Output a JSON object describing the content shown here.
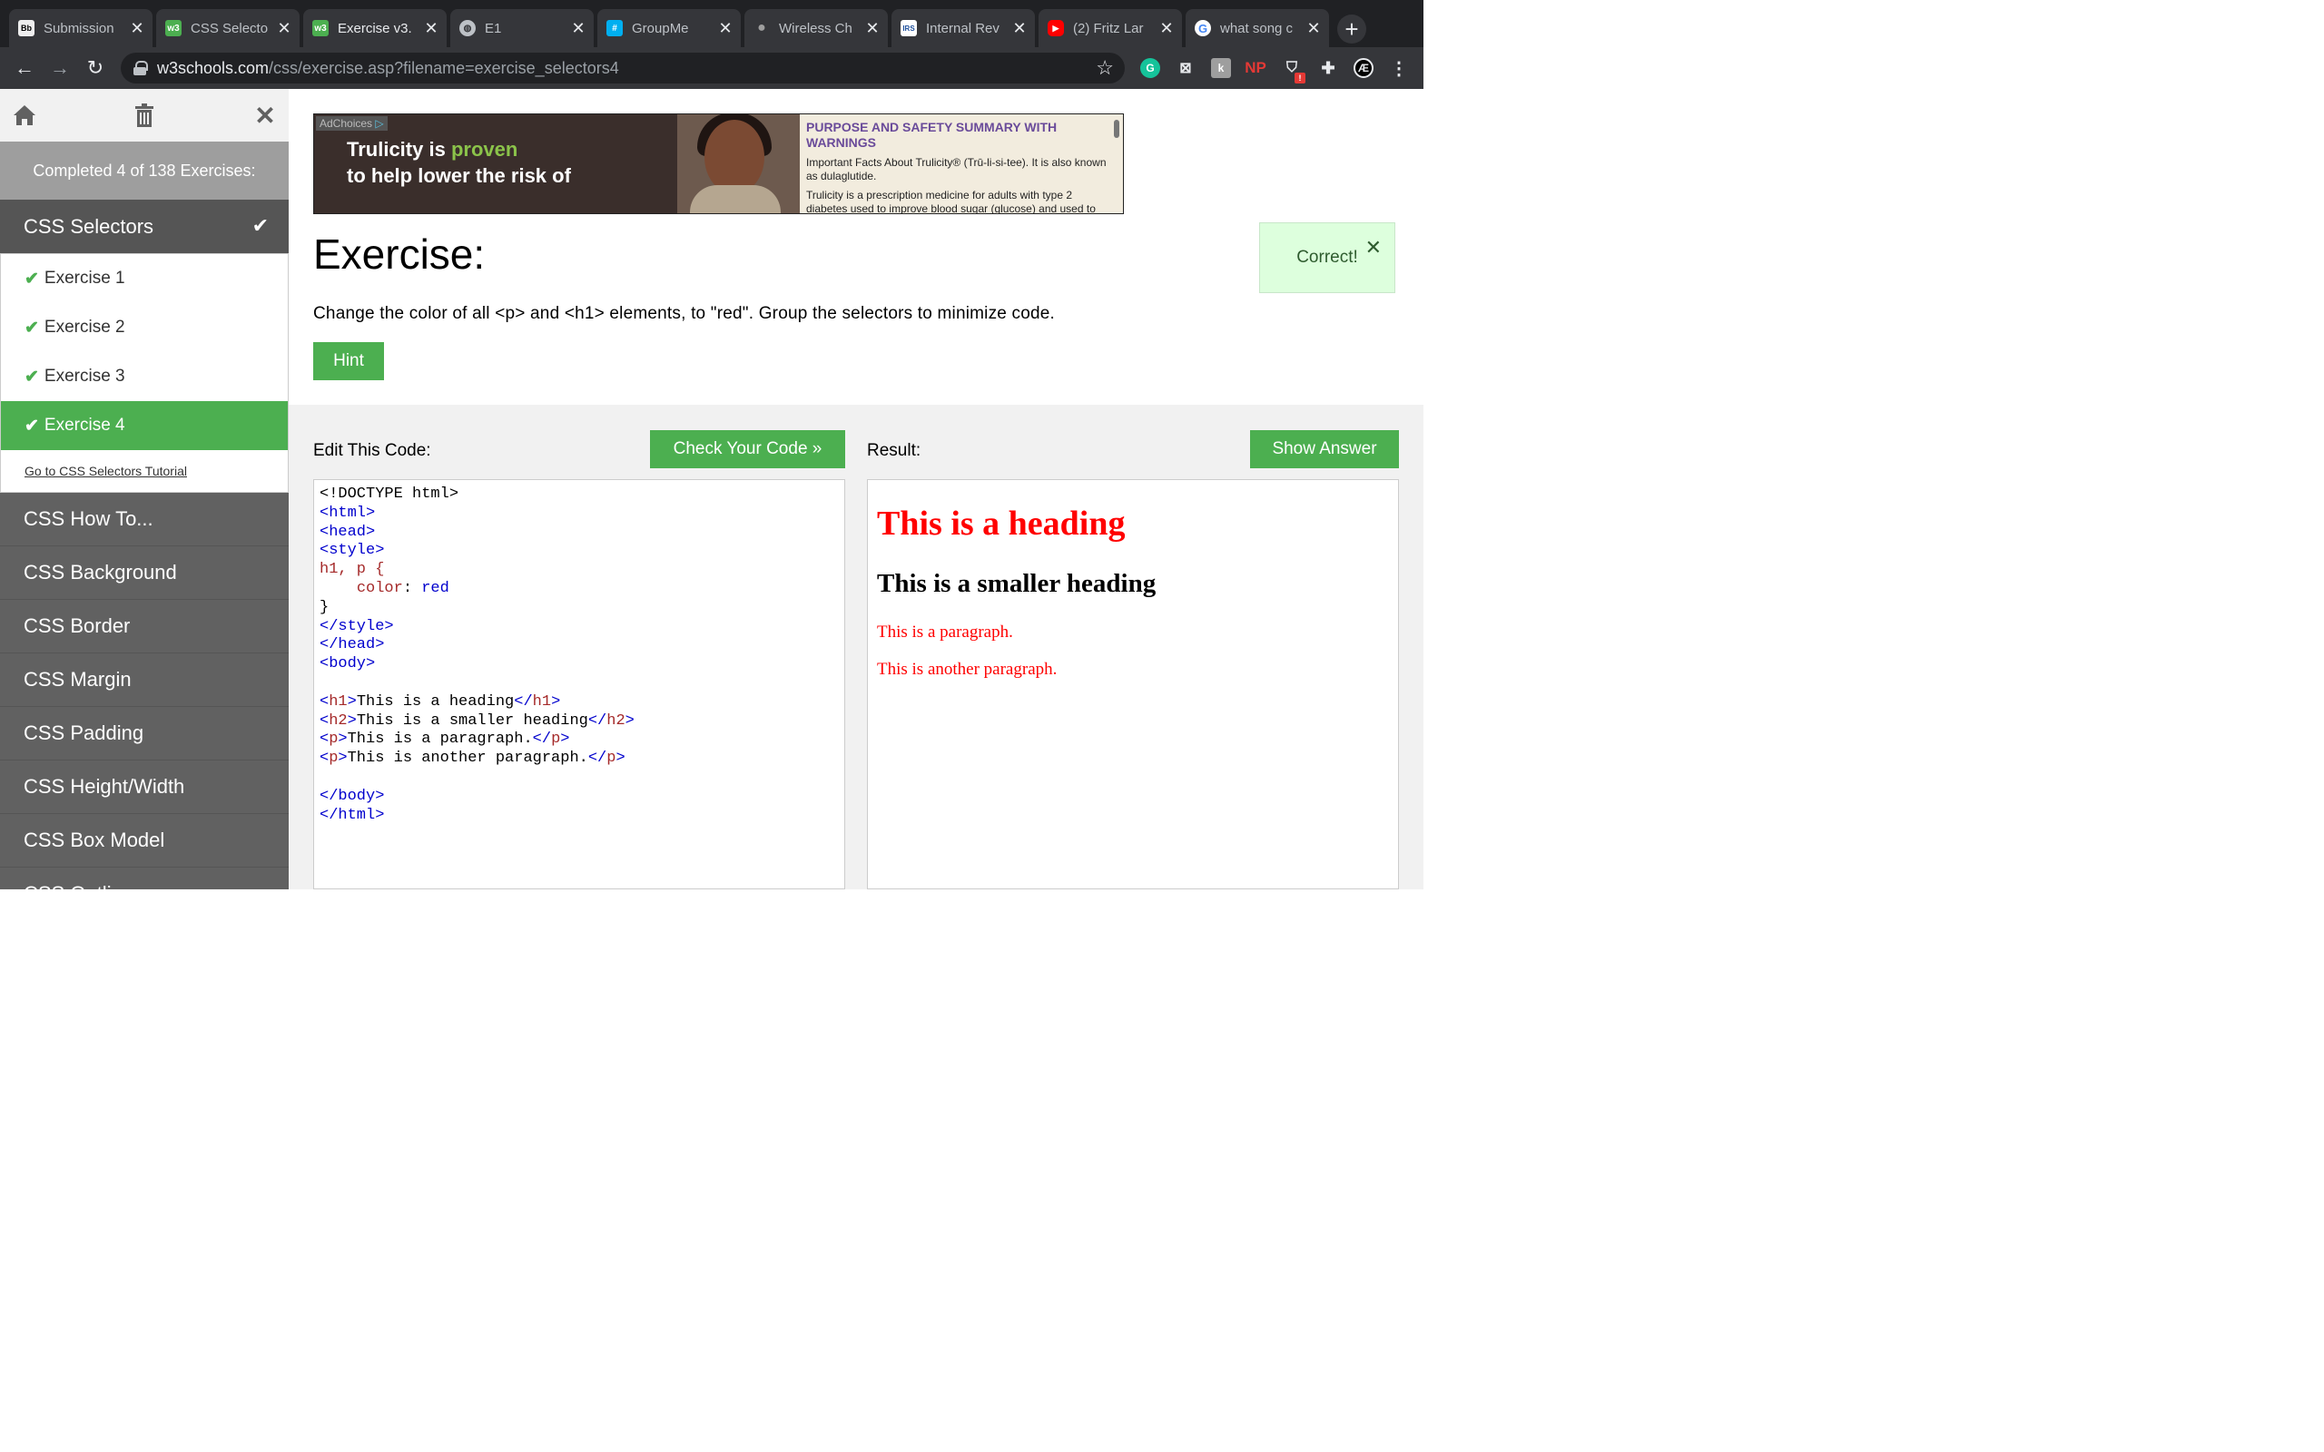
{
  "browser": {
    "tabs": [
      {
        "title": "Submission",
        "favicon": "Bb",
        "favicon_color": "#000000",
        "active": false
      },
      {
        "title": "CSS Selecto",
        "favicon": "w3",
        "favicon_color": "#4caf50",
        "active": false
      },
      {
        "title": "Exercise v3.",
        "favicon": "w3",
        "favicon_color": "#4caf50",
        "active": true
      },
      {
        "title": "E1",
        "favicon": "globe",
        "favicon_color": "#bdc1c6",
        "active": false
      },
      {
        "title": "GroupMe",
        "favicon": "#",
        "favicon_color": "#00aff0",
        "active": false
      },
      {
        "title": "Wireless Ch",
        "favicon": "apple",
        "favicon_color": "#9e9e9e",
        "active": false
      },
      {
        "title": "Internal Rev",
        "favicon": "IRS",
        "favicon_color": "#1e4f9c",
        "active": false
      },
      {
        "title": "(2) Fritz Lar",
        "favicon": "youtube",
        "favicon_color": "#ff0000",
        "active": false
      },
      {
        "title": "what song c",
        "favicon": "G",
        "favicon_color": "#ffffff",
        "active": false
      }
    ],
    "url_host": "w3schools.com",
    "url_path": "/css/exercise.asp?filename=exercise_selectors4",
    "extensions": [
      {
        "name": "grammarly-icon",
        "glyph": "G",
        "color": "#15c39a"
      },
      {
        "name": "ext-m-icon",
        "glyph": "⊠",
        "color": "#3c4043"
      },
      {
        "name": "ext-k-icon",
        "glyph": "ꝁ",
        "color": "#9e9e9e"
      },
      {
        "name": "np-icon",
        "glyph": "NP",
        "color": "#e53935"
      },
      {
        "name": "ext-alert-icon",
        "glyph": "!",
        "color": "#e53935"
      },
      {
        "name": "puzzle-icon",
        "glyph": "✚",
        "color": "#35363a"
      },
      {
        "name": "profile-icon",
        "glyph": "Æ",
        "color": "#000000"
      }
    ]
  },
  "sidebar": {
    "completed_text": "Completed 4 of 138 Exercises:",
    "active_category": "CSS Selectors",
    "exercises": [
      "Exercise 1",
      "Exercise 2",
      "Exercise 3",
      "Exercise 4"
    ],
    "active_exercise_index": 3,
    "tutorial_link": "Go to CSS Selectors Tutorial",
    "categories": [
      "CSS How To...",
      "CSS Background",
      "CSS Border",
      "CSS Margin",
      "CSS Padding",
      "CSS Height/Width",
      "CSS Box Model",
      "CSS Outline"
    ]
  },
  "ad": {
    "adchoices": "AdChoices",
    "headline_1_a": "Trulicity is ",
    "headline_1_b": "proven",
    "headline_2": "to help lower the risk of",
    "copy_title": "PURPOSE AND SAFETY SUMMARY WITH WARNINGS",
    "copy_p1": "Important Facts About Trulicity® (Trū-li-si-tee). It is also known as dulaglutide.",
    "copy_p2": "Trulicity is a prescription medicine for adults with type 2 diabetes used to improve blood sugar (glucose) and used to"
  },
  "exercise": {
    "title": "Exercise:",
    "instructions": "Change the color of all <p> and <h1> elements, to \"red\". Group the selectors to minimize code.",
    "hint_label": "Hint",
    "correct_label": "Correct!"
  },
  "editor": {
    "edit_label": "Edit This Code:",
    "check_label": "Check Your Code »",
    "result_label": "Result:",
    "answer_label": "Show Answer",
    "code": {
      "doctype": "<!DOCTYPE html>",
      "html_open": "<html>",
      "head_open": "<head>",
      "style_open": "<style>",
      "selector": "h1, p {",
      "prop": "color",
      "value": "red",
      "brace_close": "}",
      "style_close": "</style>",
      "head_close": "</head>",
      "body_open": "<body>",
      "h1_text": "This is a heading",
      "h2_text": "This is a smaller heading",
      "p1_text": "This is a paragraph.",
      "p2_text": "This is another paragraph.",
      "body_close": "</body>",
      "html_close": "</html>"
    }
  },
  "result": {
    "h1": "This is a heading",
    "h2": "This is a smaller heading",
    "p1": "This is a paragraph.",
    "p2": "This is another paragraph."
  }
}
